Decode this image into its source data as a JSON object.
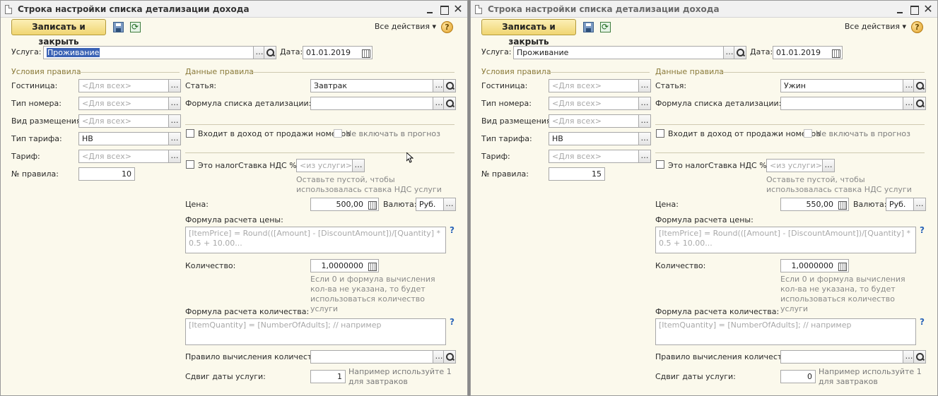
{
  "windows": [
    {
      "title": "Строка настройки списка детализации дохода",
      "toolbar": {
        "save_close": "Записать и закрыть",
        "all_actions": "Все действия",
        "help": "?"
      },
      "header": {
        "service_label": "Услуга:",
        "service_value": "Проживание",
        "date_label": "Дата:",
        "date_value": "01.01.2019"
      },
      "conditions": {
        "title": "Условия правила",
        "hotel_label": "Гостиница:",
        "hotel_value": "<Для всех>",
        "room_type_label": "Тип номера:",
        "room_type_value": "<Для всех>",
        "accommodation_label": "Вид размещения:",
        "accommodation_value": "<Для всех>",
        "rate_type_label": "Тип тарифа:",
        "rate_type_value": "НВ",
        "rate_label": "Тариф:",
        "rate_value": "<Для всех>",
        "rule_no_label": "№ правила:",
        "rule_no_value": "10"
      },
      "rule": {
        "title": "Данные правила",
        "article_label": "Статья:",
        "article_value": "Завтрак",
        "detail_formula_label": "Формула списка детализации:",
        "detail_formula_value": "",
        "income_label": "Входит в доход от продажи номеров",
        "forecast_label": "Не включать в прогноз",
        "tax_label": "Это налог",
        "vat_label": "Ставка НДС %:",
        "vat_value": "<из услуги>",
        "vat_note": "Оставьте пустой, чтобы использовалась ставка НДС услуги",
        "price_label": "Цена:",
        "price_value": "500,00",
        "currency_label": "Валюта:",
        "currency_value": "Руб.",
        "price_formula_label": "Формула расчета цены:",
        "price_formula_placeholder": "[ItemPrice] = Round(([Amount] - [DiscountAmount])/[Quantity] * 0.5 + 10.00...",
        "quantity_label": "Количество:",
        "quantity_value": "1,0000000",
        "quantity_note": "Если 0 и формула вычисления кол-ва не указана, то будет использоваться количество услуги",
        "quantity_formula_label": "Формула расчета количества:",
        "quantity_formula_placeholder": "[ItemQuantity] = [NumberOfAdults]; // например",
        "quantity_rule_label": "Правило вычисления количества:",
        "quantity_rule_value": "",
        "date_shift_label": "Сдвиг даты услуги:",
        "date_shift_value": "1",
        "date_shift_note": "Например используйте 1 для завтраков"
      }
    },
    {
      "title": "Строка настройки списка детализации дохода",
      "toolbar": {
        "save_close": "Записать и закрыть",
        "all_actions": "Все действия",
        "help": "?"
      },
      "header": {
        "service_label": "Услуга:",
        "service_value": "Проживание",
        "date_label": "Дата:",
        "date_value": "01.01.2019"
      },
      "conditions": {
        "title": "Условия правила",
        "hotel_label": "Гостиница:",
        "hotel_value": "<Для всех>",
        "room_type_label": "Тип номера:",
        "room_type_value": "<Для всех>",
        "accommodation_label": "Вид размещения:",
        "accommodation_value": "<Для всех>",
        "rate_type_label": "Тип тарифа:",
        "rate_type_value": "НВ",
        "rate_label": "Тариф:",
        "rate_value": "<Для всех>",
        "rule_no_label": "№ правила:",
        "rule_no_value": "15"
      },
      "rule": {
        "title": "Данные правила",
        "article_label": "Статья:",
        "article_value": "Ужин",
        "detail_formula_label": "Формула списка детализации:",
        "detail_formula_value": "",
        "income_label": "Входит в доход от продажи номеров",
        "forecast_label": "Не включать в прогноз",
        "tax_label": "Это налог",
        "vat_label": "Ставка НДС %:",
        "vat_value": "<из услуги>",
        "vat_note": "Оставьте пустой, чтобы использовалась ставка НДС услуги",
        "price_label": "Цена:",
        "price_value": "550,00",
        "currency_label": "Валюта:",
        "currency_value": "Руб.",
        "price_formula_label": "Формула расчета цены:",
        "price_formula_placeholder": "[ItemPrice] = Round(([Amount] - [DiscountAmount])/[Quantity] * 0.5 + 10.00...",
        "quantity_label": "Количество:",
        "quantity_value": "1,0000000",
        "quantity_note": "Если 0 и формула вычисления кол-ва не указана, то будет использоваться количество услуги",
        "quantity_formula_label": "Формула расчета количества:",
        "quantity_formula_placeholder": "[ItemQuantity] = [NumberOfAdults]; // например",
        "quantity_rule_label": "Правило вычисления количества:",
        "quantity_rule_value": "",
        "date_shift_label": "Сдвиг даты услуги:",
        "date_shift_value": "0",
        "date_shift_note": "Например используйте 1 для завтраков"
      }
    }
  ]
}
